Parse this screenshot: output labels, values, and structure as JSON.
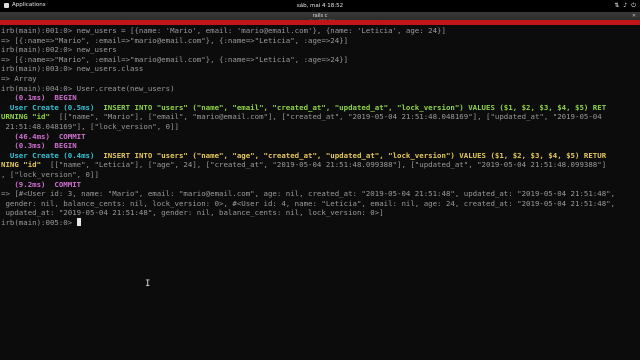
{
  "system": {
    "apps_label": "Applications",
    "clock": "sáb, mai 4  18:52",
    "tray_icons": [
      "network-icon",
      "volume-icon",
      "power-icon"
    ]
  },
  "window": {
    "title": "rails c",
    "subtitle": "rails c 136x34"
  },
  "terminal": {
    "lines": [
      [
        {
          "t": "irb(main):001:0> new_users = [{name: 'Mario', email: 'mario@email.com'}, {name: 'Leticia', age: 24}]",
          "c": "d"
        }
      ],
      [
        {
          "t": "=> [{:name=>\"Mario\", :email=>\"mario@email.com\"}, {:name=>\"Leticia\", :age=>24}]",
          "c": "d"
        }
      ],
      [
        {
          "t": "irb(main):002:0> new_users",
          "c": "d"
        }
      ],
      [
        {
          "t": "=> [{:name=>\"Mario\", :email=>\"mario@email.com\"}, {:name=>\"Leticia\", :age=>24}]",
          "c": "d"
        }
      ],
      [
        {
          "t": "irb(main):003:0> new_users.class",
          "c": "d"
        }
      ],
      [
        {
          "t": "=> Array",
          "c": "d"
        }
      ],
      [
        {
          "t": "irb(main):004:0> User.create(new_users)",
          "c": "d"
        }
      ],
      [
        {
          "t": "   (0.1ms)  ",
          "c": "m"
        },
        {
          "t": "BEGIN",
          "c": "m"
        }
      ],
      [
        {
          "t": "  User Create (0.5ms)  ",
          "c": "c"
        },
        {
          "t": "INSERT INTO \"users\" (\"name\", \"email\", \"created_at\", \"updated_at\", \"lock_version\") VALUES ($1, $2, $3, $4, $5) RET",
          "c": "g"
        }
      ],
      [
        {
          "t": "URNING \"id\"",
          "c": "g"
        },
        {
          "t": "  [[\"name\", \"Mario\"], [\"email\", \"mario@email.com\"], [\"created_at\", \"2019-05-04 21:51:48.048169\"], [\"updated_at\", \"2019-05-04",
          "c": "d"
        }
      ],
      [
        {
          "t": " 21:51:48.048169\"], [\"lock_version\", 0]]",
          "c": "d"
        }
      ],
      [
        {
          "t": "   (46.4ms)  ",
          "c": "m"
        },
        {
          "t": "COMMIT",
          "c": "m"
        }
      ],
      [
        {
          "t": "   (0.3ms)  ",
          "c": "m"
        },
        {
          "t": "BEGIN",
          "c": "m"
        }
      ],
      [
        {
          "t": "  User Create (0.4ms)  ",
          "c": "c"
        },
        {
          "t": "INSERT INTO \"users\" (\"name\", \"age\", \"created_at\", \"updated_at\", \"lock_version\") VALUES ($1, $2, $3, $4, $5) RETUR",
          "c": "y"
        }
      ],
      [
        {
          "t": "NING \"id\"",
          "c": "y"
        },
        {
          "t": "  [[\"name\", \"Leticia\"], [\"age\", 24], [\"created_at\", \"2019-05-04 21:51:48.099388\"], [\"updated_at\", \"2019-05-04 21:51:48.099388\"]",
          "c": "d"
        }
      ],
      [
        {
          "t": ", [\"lock_version\", 0]]",
          "c": "d"
        }
      ],
      [
        {
          "t": "   (9.2ms)  ",
          "c": "m"
        },
        {
          "t": "COMMIT",
          "c": "m"
        }
      ],
      [
        {
          "t": "=> [#<User id: 3, name: \"Mario\", email: \"mario@email.com\", age: nil, created_at: \"2019-05-04 21:51:48\", updated_at: \"2019-05-04 21:51:48\",",
          "c": "d"
        }
      ],
      [
        {
          "t": " gender: nil, balance_cents: nil, lock_version: 0>, #<User id: 4, name: \"Leticia\", email: nil, age: 24, created_at: \"2019-05-04 21:51:48\",",
          "c": "d"
        }
      ],
      [
        {
          "t": " updated_at: \"2019-05-04 21:51:48\", gender: nil, balance_cents: nil, lock_version: 0>]",
          "c": "d"
        }
      ],
      [
        {
          "t": "irb(main):005:0> ",
          "c": "d"
        }
      ]
    ]
  }
}
